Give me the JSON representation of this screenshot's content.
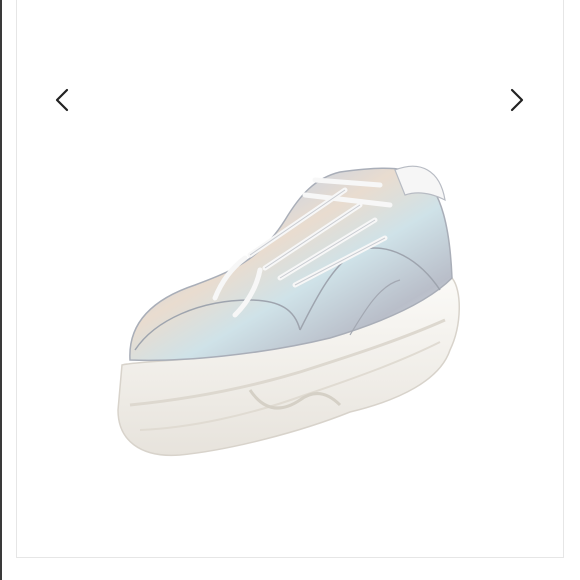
{
  "gallery": {
    "prev_icon": "chevron-left-icon",
    "next_icon": "chevron-right-icon",
    "image_subject": "holographic-platform-sneaker"
  },
  "colors": {
    "arrow": "#222222",
    "sole": "#f4f1ec",
    "upper_silver": "#d9dde3"
  }
}
